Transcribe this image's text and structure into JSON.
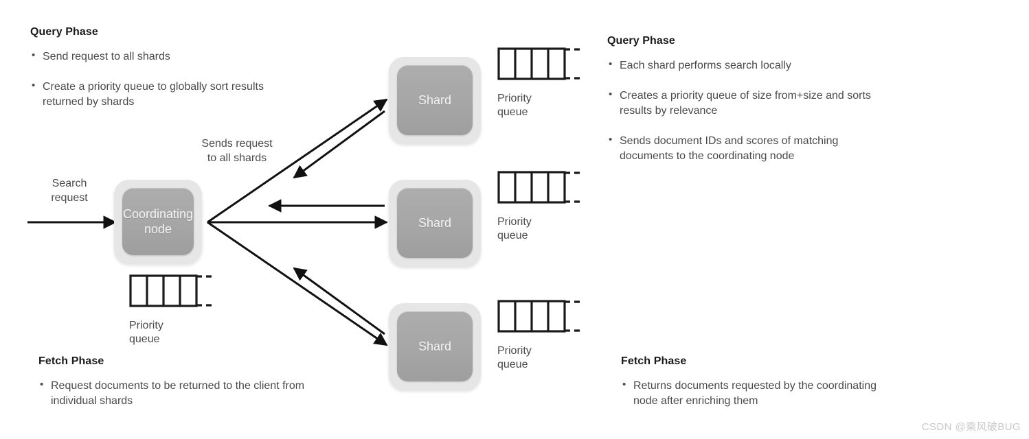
{
  "left_panel": {
    "query": {
      "title": "Query Phase",
      "bullets": [
        "Send request to all shards",
        "Create a priority queue to globally sort results returned by shards"
      ]
    },
    "fetch": {
      "title": "Fetch Phase",
      "bullets": [
        "Request documents to be returned to the client from individual shards"
      ]
    }
  },
  "right_panel": {
    "query": {
      "title": "Query Phase",
      "bullets": [
        "Each shard performs search locally",
        "Creates a priority queue of size from+size and sorts results by relevance",
        "Sends document IDs and scores of matching documents to the coordinating node"
      ]
    },
    "fetch": {
      "title": "Fetch Phase",
      "bullets": [
        "Returns documents requested by the coordinating node after enriching them"
      ]
    }
  },
  "diagram": {
    "search_request_label": "Search\nrequest",
    "sends_request_label": "Sends request\nto all shards",
    "coordinating_node": "Coordinating\nnode",
    "shards": [
      {
        "label": "Shard"
      },
      {
        "label": "Shard"
      },
      {
        "label": "Shard"
      }
    ],
    "priority_queues": [
      {
        "label": "Priority\nqueue",
        "cells": 4
      },
      {
        "label": "Priority\nqueue",
        "cells": 4
      },
      {
        "label": "Priority\nqueue",
        "cells": 4
      },
      {
        "label": "Priority\nqueue",
        "cells": 4
      }
    ],
    "colors": {
      "node_outer": "#e6e6e6",
      "node_inner": "#a8a8a8",
      "node_text": "#f4f4f4",
      "arrow": "#111111",
      "body_text": "#4a4a4a",
      "heading_text": "#1a1a1a",
      "background": "#ffffff"
    }
  },
  "watermark": "CSDN @乘风破BUG"
}
